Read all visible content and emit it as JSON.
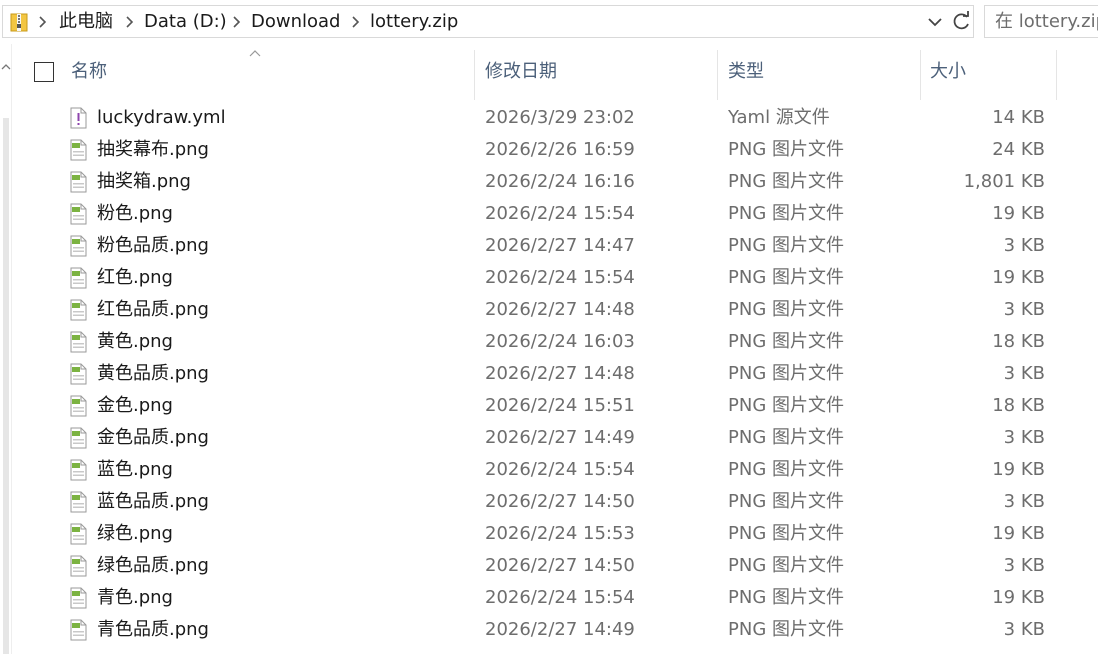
{
  "address_bar": {
    "breadcrumbs": [
      "此电脑",
      "Data (D:)",
      "Download",
      "lottery.zip"
    ],
    "search_placeholder": "在 lottery.zip 中搜索"
  },
  "columns": {
    "name": "名称",
    "date": "修改日期",
    "type": "类型",
    "size": "大小"
  },
  "files": [
    {
      "name": "luckydraw.yml",
      "date": "2026/3/29 23:02",
      "type": "Yaml 源文件",
      "size": "14 KB",
      "icon": "yaml-file-icon"
    },
    {
      "name": "抽奖幕布.png",
      "date": "2026/2/26 16:59",
      "type": "PNG 图片文件",
      "size": "24 KB",
      "icon": "png-file-icon"
    },
    {
      "name": "抽奖箱.png",
      "date": "2026/2/24 16:16",
      "type": "PNG 图片文件",
      "size": "1,801 KB",
      "icon": "png-file-icon"
    },
    {
      "name": "粉色.png",
      "date": "2026/2/24 15:54",
      "type": "PNG 图片文件",
      "size": "19 KB",
      "icon": "png-file-icon"
    },
    {
      "name": "粉色品质.png",
      "date": "2026/2/27 14:47",
      "type": "PNG 图片文件",
      "size": "3 KB",
      "icon": "png-file-icon"
    },
    {
      "name": "红色.png",
      "date": "2026/2/24 15:54",
      "type": "PNG 图片文件",
      "size": "19 KB",
      "icon": "png-file-icon"
    },
    {
      "name": "红色品质.png",
      "date": "2026/2/27 14:48",
      "type": "PNG 图片文件",
      "size": "3 KB",
      "icon": "png-file-icon"
    },
    {
      "name": "黄色.png",
      "date": "2026/2/24 16:03",
      "type": "PNG 图片文件",
      "size": "18 KB",
      "icon": "png-file-icon"
    },
    {
      "name": "黄色品质.png",
      "date": "2026/2/27 14:48",
      "type": "PNG 图片文件",
      "size": "3 KB",
      "icon": "png-file-icon"
    },
    {
      "name": "金色.png",
      "date": "2026/2/24 15:51",
      "type": "PNG 图片文件",
      "size": "18 KB",
      "icon": "png-file-icon"
    },
    {
      "name": "金色品质.png",
      "date": "2026/2/27 14:49",
      "type": "PNG 图片文件",
      "size": "3 KB",
      "icon": "png-file-icon"
    },
    {
      "name": "蓝色.png",
      "date": "2026/2/24 15:54",
      "type": "PNG 图片文件",
      "size": "19 KB",
      "icon": "png-file-icon"
    },
    {
      "name": "蓝色品质.png",
      "date": "2026/2/27 14:50",
      "type": "PNG 图片文件",
      "size": "3 KB",
      "icon": "png-file-icon"
    },
    {
      "name": "绿色.png",
      "date": "2026/2/24 15:53",
      "type": "PNG 图片文件",
      "size": "19 KB",
      "icon": "png-file-icon"
    },
    {
      "name": "绿色品质.png",
      "date": "2026/2/27 14:50",
      "type": "PNG 图片文件",
      "size": "3 KB",
      "icon": "png-file-icon"
    },
    {
      "name": "青色.png",
      "date": "2026/2/24 15:54",
      "type": "PNG 图片文件",
      "size": "19 KB",
      "icon": "png-file-icon"
    },
    {
      "name": "青色品质.png",
      "date": "2026/2/27 14:49",
      "type": "PNG 图片文件",
      "size": "3 KB",
      "icon": "png-file-icon"
    }
  ],
  "colors": {
    "header_text": "#4c607a",
    "secondary_text": "#6d6d6d",
    "png_icon_green": "#7cb342",
    "yaml_icon_purple": "#8e44ad"
  }
}
